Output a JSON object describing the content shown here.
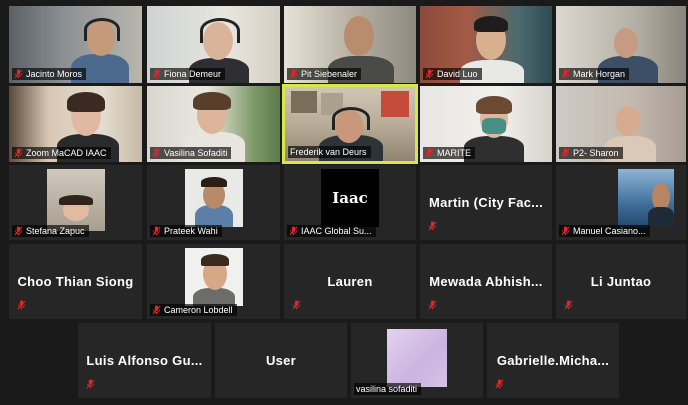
{
  "meeting": {
    "row1": [
      {
        "name": "Jacinto Moros"
      },
      {
        "name": "Fiona Demeur"
      },
      {
        "name": "Pit Siebenaler"
      },
      {
        "name": "David Luo"
      },
      {
        "name": "Mark Horgan"
      }
    ],
    "row2": [
      {
        "name": "Zoom MaCAD IAAC"
      },
      {
        "name": "Vasilina Sofaditi"
      },
      {
        "name": "Frederik van Deurs"
      },
      {
        "name": "MARITE"
      },
      {
        "name": "P2- Sharon"
      }
    ],
    "row3": [
      {
        "name": "Stefana Zapuc"
      },
      {
        "name": "Prateek Wahi"
      },
      {
        "name": "IAAC Global Su...",
        "logo_text": "Iaac"
      },
      {
        "display_name": "Martin  (City Fac..."
      },
      {
        "name": "Manuel Casiano..."
      }
    ],
    "row4": [
      {
        "display_name": "Choo Thian Siong"
      },
      {
        "name": "Cameron Lobdell"
      },
      {
        "display_name": "Lauren"
      },
      {
        "display_name": "Mewada  Abhish..."
      },
      {
        "display_name": "Li Juntao"
      }
    ],
    "row5": [
      {
        "display_name": "Luis Alfonso Gu..."
      },
      {
        "display_name": "User"
      },
      {
        "name": "vasilina sofaditi"
      },
      {
        "display_name": "Gabrielle.Micha..."
      }
    ],
    "active_speaker": "Frederik van Deurs",
    "colors": {
      "background": "#1a1a1a",
      "tile": "#262626",
      "active_border": "#d8e64a",
      "muted_icon": "#e02828"
    }
  }
}
